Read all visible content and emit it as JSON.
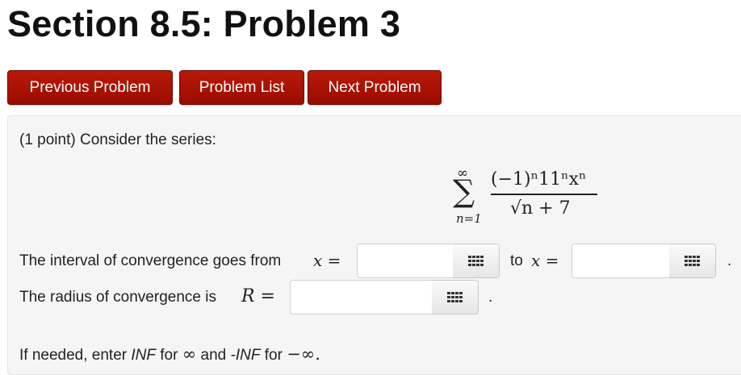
{
  "page": {
    "title": "Section 8.5: Problem 3"
  },
  "nav": {
    "previous": "Previous Problem",
    "list": "Problem List",
    "next": "Next Problem"
  },
  "problem": {
    "intro": "(1 point) Consider the series:",
    "series": {
      "sum_upper": "∞",
      "sum_lower": "n=1",
      "numerator": "(−1)ⁿ11ⁿxⁿ",
      "denominator": "√n + 7"
    },
    "interval_label": "The interval of convergence goes from",
    "x_eq": "x =",
    "to_label": "to",
    "x_eq2": "x =",
    "period1": ".",
    "radius_label": "The radius of convergence is",
    "r_eq": "R =",
    "period2": ".",
    "hint_part1": "If needed, enter",
    "hint_inf": "INF",
    "hint_part2": "for",
    "hint_infty": "∞",
    "hint_part3": "and",
    "hint_neginf": "-INF",
    "hint_part4": "for",
    "hint_neginfty": "−∞."
  },
  "inputs": {
    "interval_start": "",
    "interval_end": "",
    "radius": ""
  },
  "icons": {
    "equation_editor": "grid-icon"
  },
  "colors": {
    "button_red": "#a81000",
    "panel_bg": "#f5f5f5"
  }
}
